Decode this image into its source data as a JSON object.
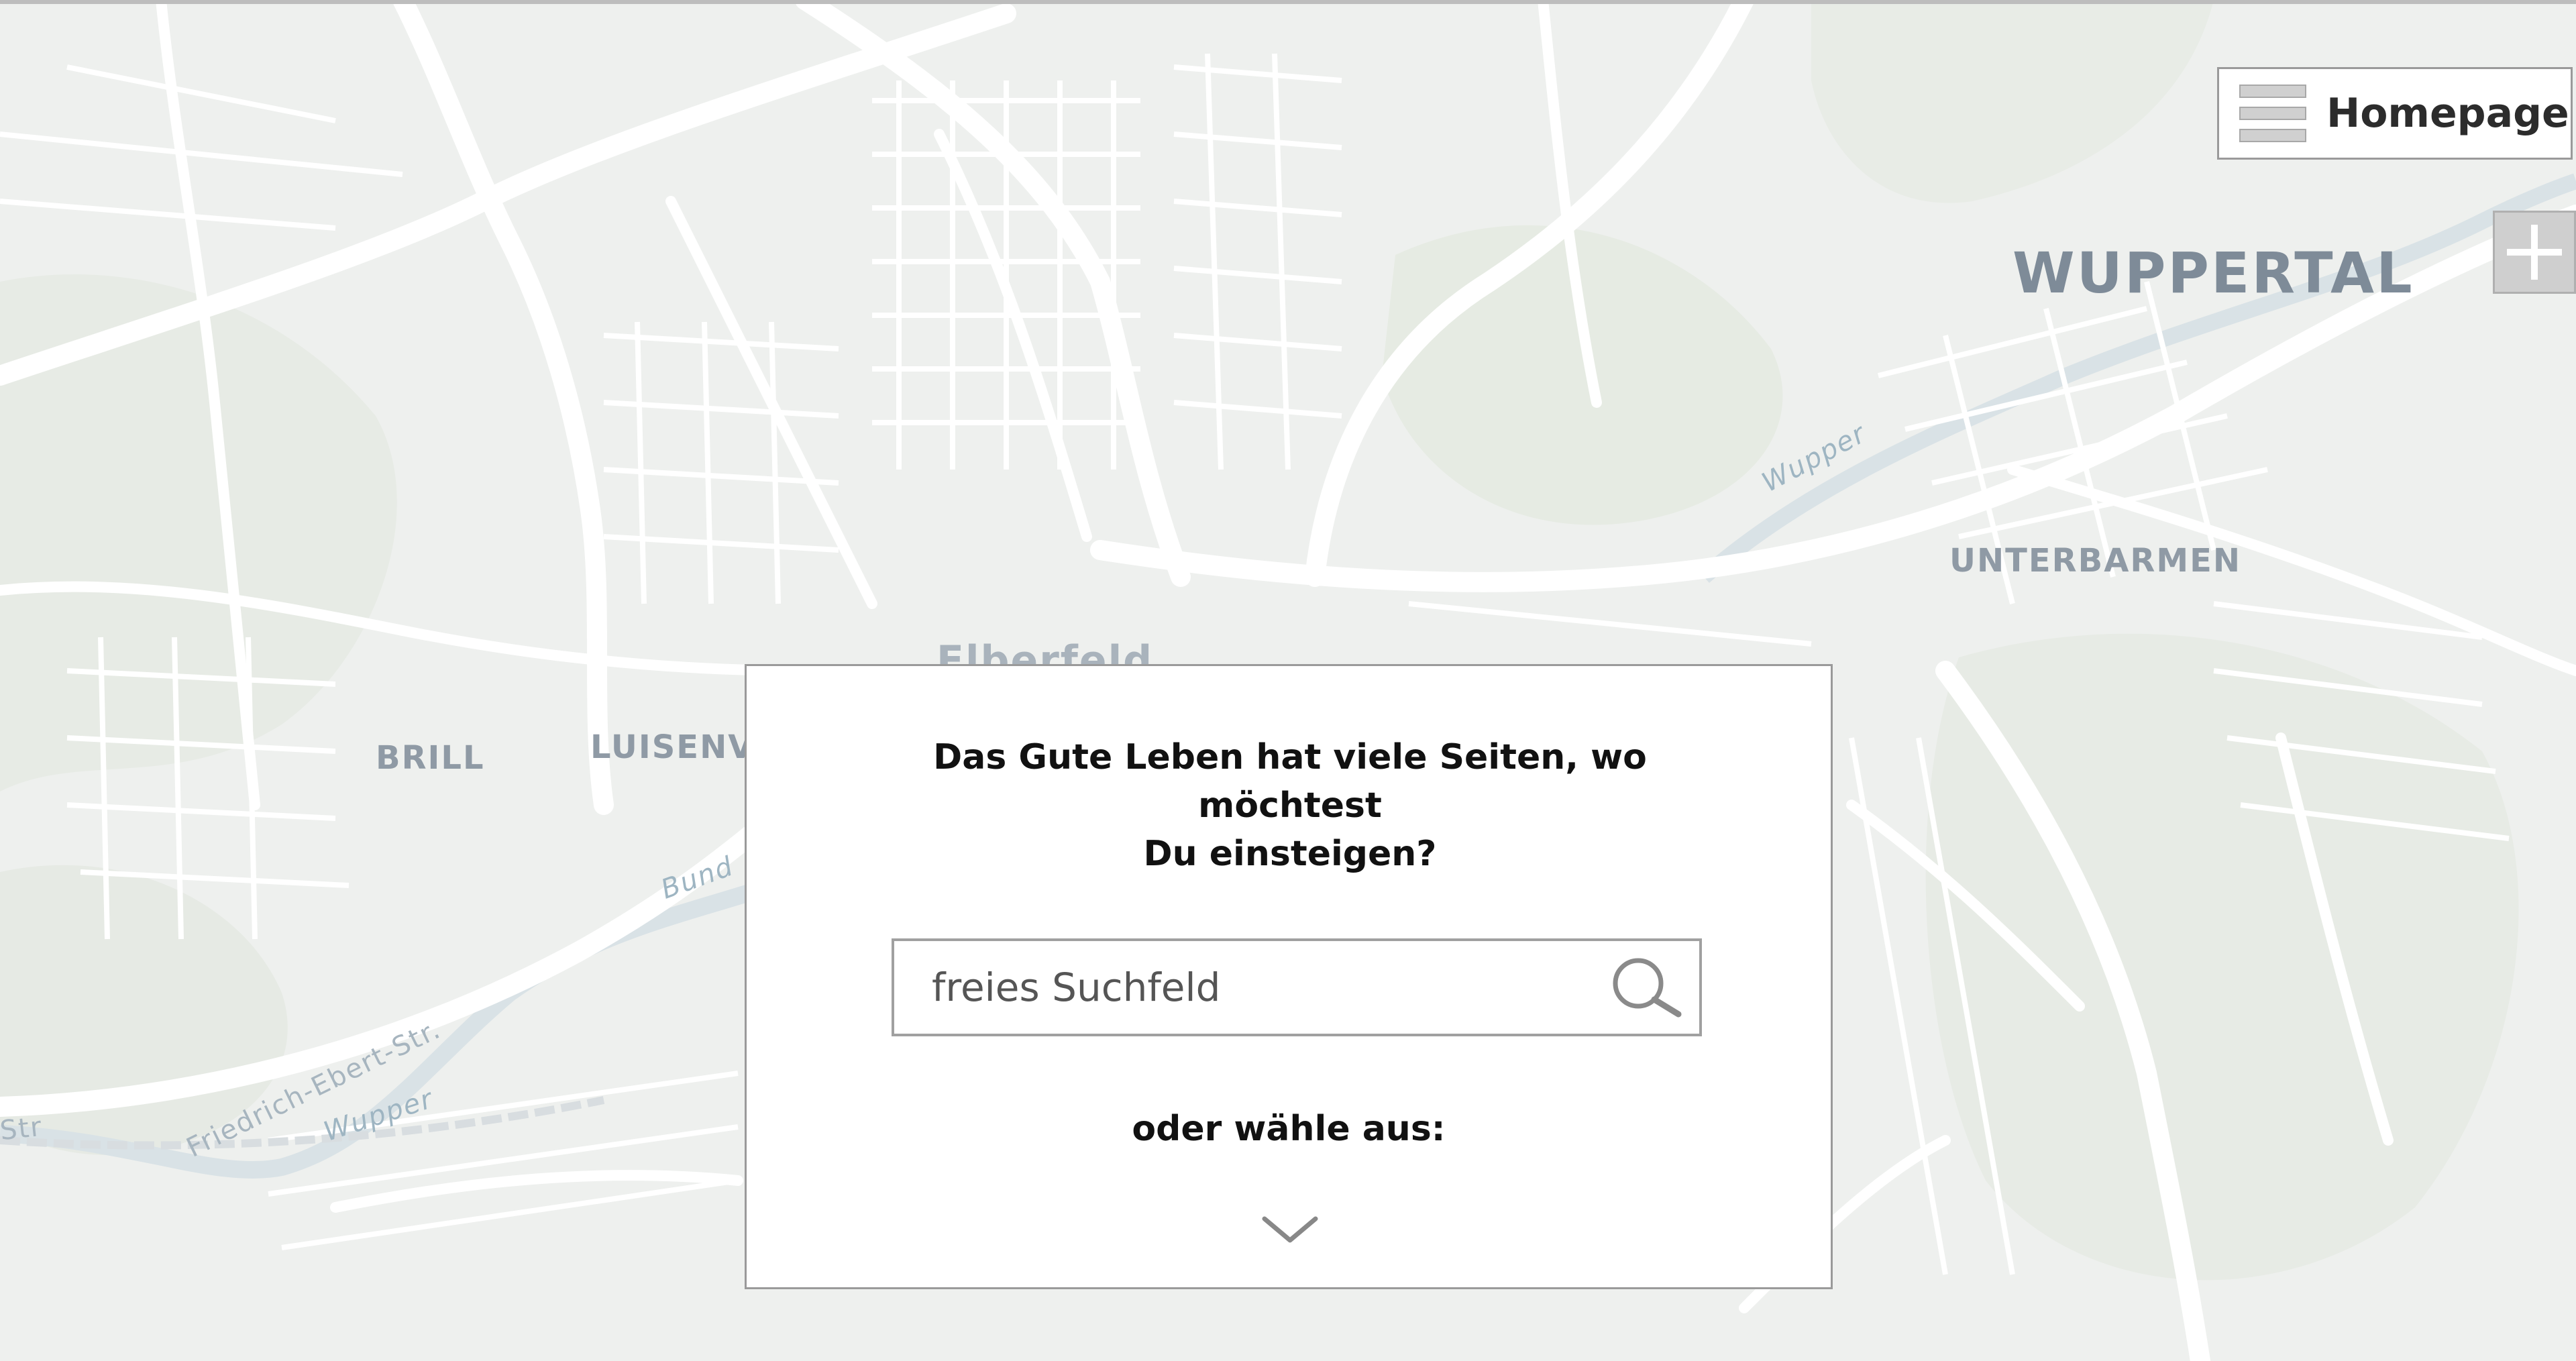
{
  "header": {
    "menu_label": "Homepage"
  },
  "map": {
    "labels": {
      "city": "WUPPERTAL",
      "unterbarmen": "UNTERBARMEN",
      "elberfeld": "Elberfeld",
      "brill": "BRILL",
      "luisenviertel": "LUISENV",
      "wupper_top": "Wupper",
      "wupper_bottom": "Wupper",
      "bund": "Bund",
      "friedrich_ebert": "Friedrich-Ebert-Str.",
      "str_left": "Str"
    }
  },
  "dialog": {
    "title_line1": "Das Gute Leben hat viele Seiten, wo möchtest",
    "title_line2": "Du einsteigen?",
    "search_placeholder": "freies Suchfeld",
    "choose_label": "oder wähle aus:"
  },
  "colors": {
    "map_background": "#eef0ee",
    "road": "#ffffff",
    "park": "#e6ebe4",
    "water": "#dbe4e8",
    "label": "#8f9aa5"
  },
  "icons": {
    "menu": "hamburger-icon",
    "zoom": "plus-icon",
    "search": "search-icon",
    "expand": "chevron-down-icon"
  }
}
